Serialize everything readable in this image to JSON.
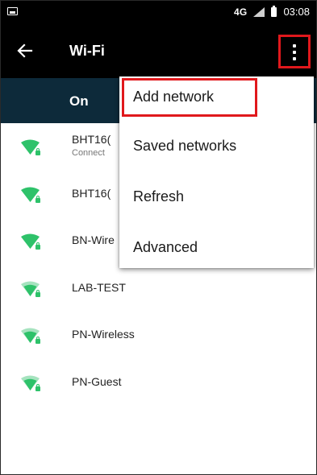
{
  "status_bar": {
    "network": "4G",
    "time": "03:08"
  },
  "app_bar": {
    "title": "Wi-Fi"
  },
  "master_switch": {
    "label": "On"
  },
  "networks": [
    {
      "ssid": "BHT16(",
      "status": "Connect"
    },
    {
      "ssid": "BHT16(",
      "status": ""
    },
    {
      "ssid": "BN-Wire",
      "status": ""
    },
    {
      "ssid": "LAB-TEST",
      "status": ""
    },
    {
      "ssid": "PN-Wireless",
      "status": ""
    },
    {
      "ssid": "PN-Guest",
      "status": ""
    }
  ],
  "overflow_menu": {
    "items": [
      "Add network",
      "Saved networks",
      "Refresh",
      "Advanced"
    ]
  },
  "colors": {
    "accent": "#2ec26a",
    "highlight": "#e0181c",
    "switch_bar": "#0d2a3a"
  }
}
